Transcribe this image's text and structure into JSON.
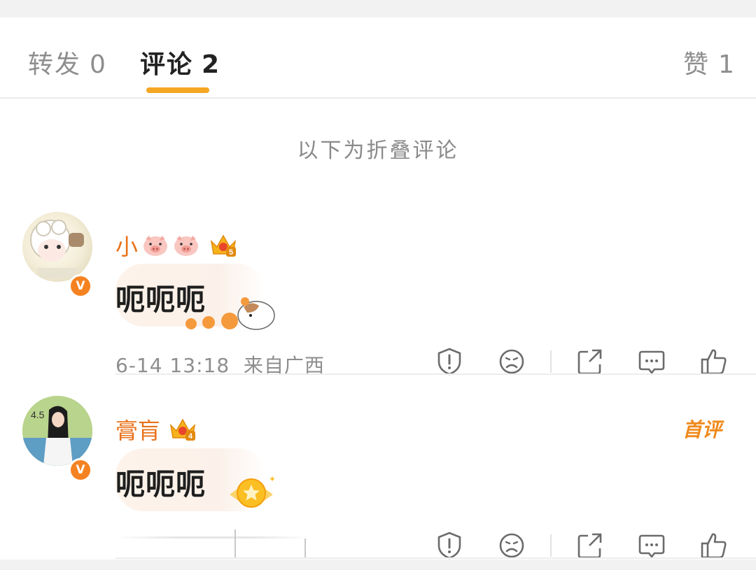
{
  "tabs": [
    {
      "label": "转发",
      "count": "0"
    },
    {
      "label": "评论",
      "count": "2"
    },
    {
      "label": "赞",
      "count": "1"
    }
  ],
  "folded_hint": "以下为折叠评论",
  "comments": [
    {
      "username": "小",
      "text": "呃呃呃",
      "time": "6-14 13:18",
      "location": "来自广西",
      "vip_level": "5",
      "verified": "V"
    },
    {
      "username": "膏肓",
      "text": "呃呃呃",
      "first_badge": "首评",
      "vip_level": "4",
      "verified": "V"
    }
  ],
  "icons": {
    "report": "shield-alert-icon",
    "dislike": "sad-face-icon",
    "share": "share-icon",
    "reply": "comment-icon",
    "like": "thumb-up-icon"
  },
  "colors": {
    "accent": "#f5a623",
    "username": "#e8711a",
    "verified": "#f58220"
  }
}
